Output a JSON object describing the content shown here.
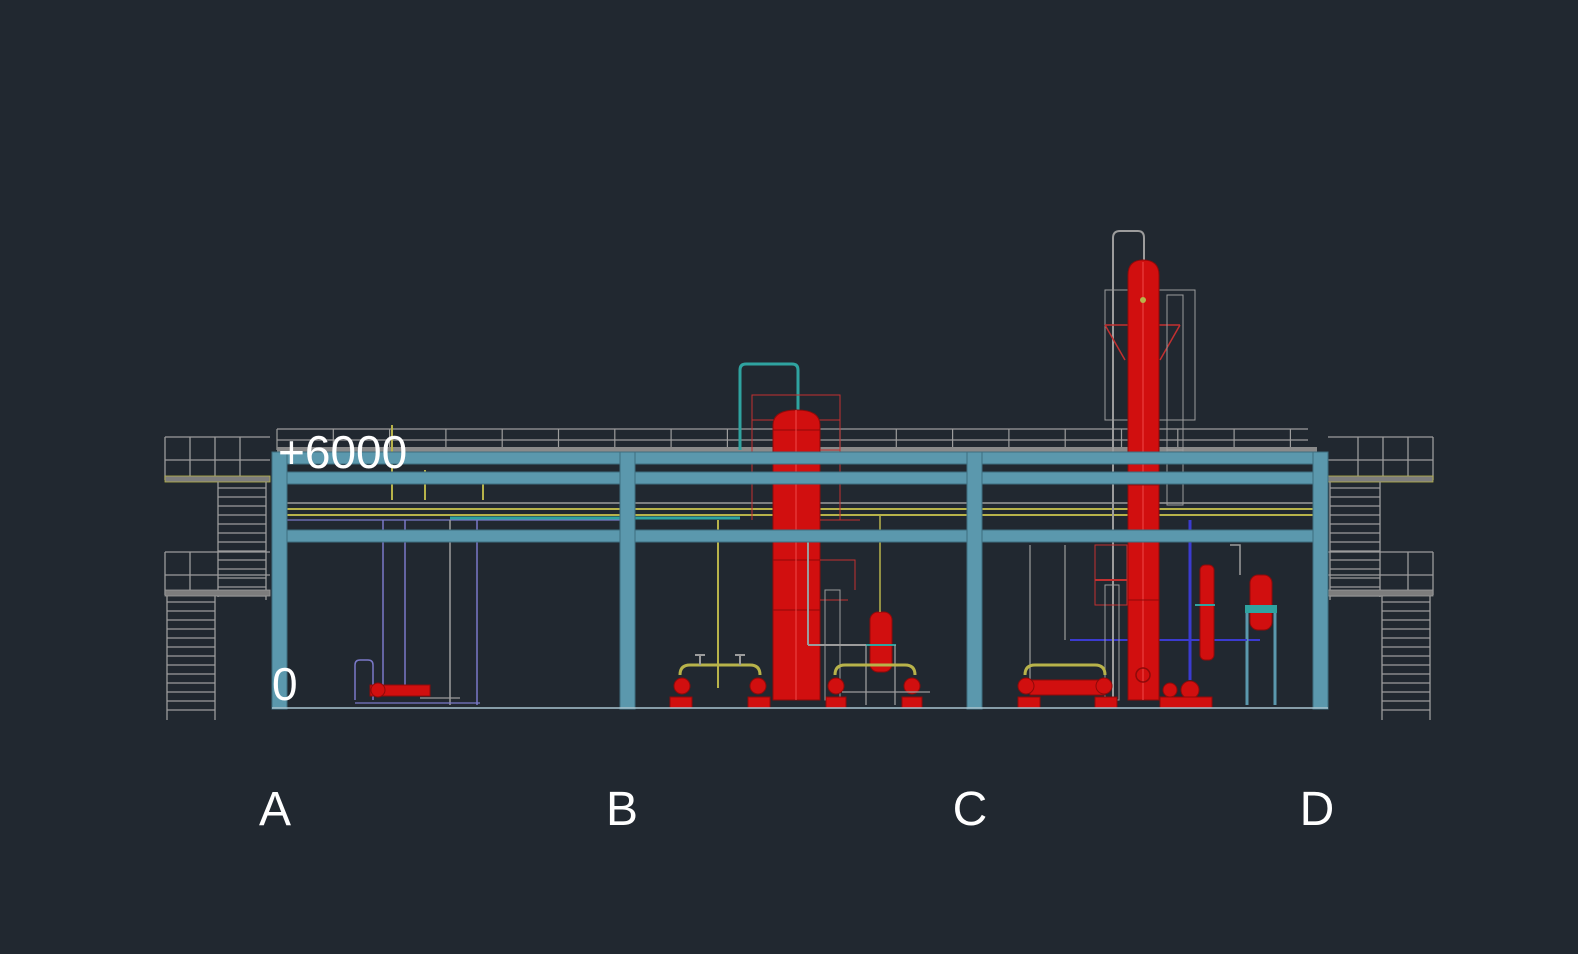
{
  "drawing": {
    "background": "#212830",
    "colors": {
      "steel": "#5b98ad",
      "vessel": "#d10f0f",
      "vessel_dark": "#8e0a0a",
      "handrail": "#9c9c9c",
      "pipe_yellow": "#b8b34a",
      "pipe_teal": "#2fa3a0",
      "pipe_blue": "#3b3bd0",
      "pipe_violet": "#7a78c8",
      "text": "#ffffff"
    },
    "grid_axes": [
      {
        "label": "A"
      },
      {
        "label": "B"
      },
      {
        "label": "C"
      },
      {
        "label": "D"
      }
    ],
    "elevations": {
      "top": "+6000",
      "ground": "0"
    }
  }
}
